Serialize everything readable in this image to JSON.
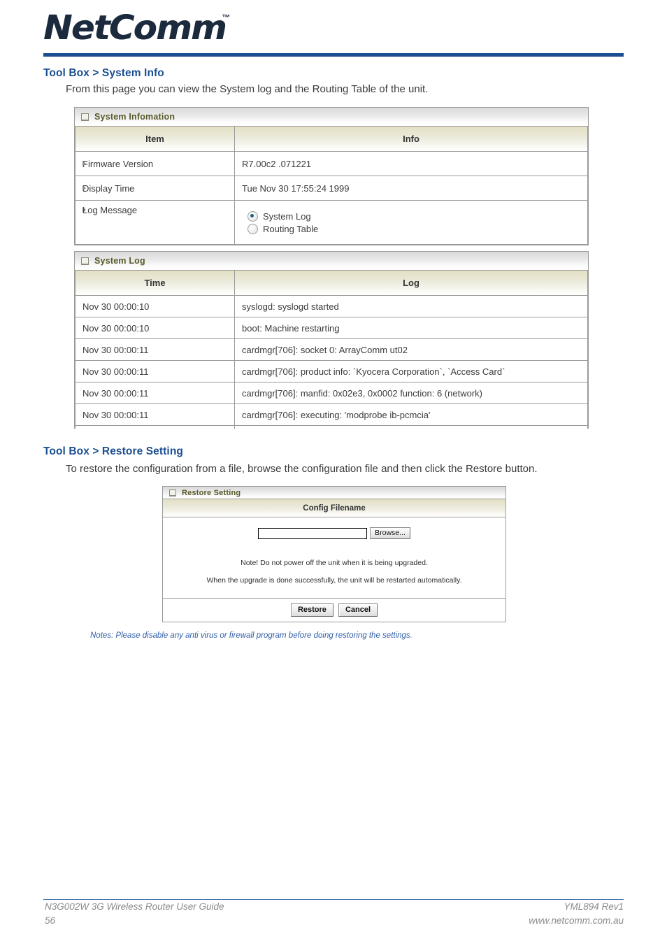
{
  "brand": {
    "logo_text": "NetComm",
    "trademark": "™"
  },
  "sections": [
    {
      "heading": "Tool Box > System Info",
      "body": "From this page you can view the System log and the Routing Table of the unit."
    },
    {
      "heading": "Tool Box > Restore Setting",
      "body": "To restore the configuration from a file, browse the configuration file and then click the Restore button."
    }
  ],
  "system_info_panel": {
    "title": "System Infomation",
    "columns": [
      "Item",
      "Info"
    ],
    "rows": [
      {
        "item": "Firmware Version",
        "info": "R7.00c2 .071221"
      },
      {
        "item": "Display Time",
        "info": "Tue Nov 30 17:55:24 1999"
      }
    ],
    "log_message_row": {
      "item": "Log Message",
      "options": [
        {
          "label": "System Log",
          "selected": true
        },
        {
          "label": "Routing Table",
          "selected": false
        }
      ]
    }
  },
  "system_log_panel": {
    "title": "System Log",
    "columns": [
      "Time",
      "Log"
    ],
    "rows": [
      {
        "time": "Nov 30 00:00:10",
        "log": "syslogd: syslogd started"
      },
      {
        "time": "Nov 30 00:00:10",
        "log": "boot: Machine restarting"
      },
      {
        "time": "Nov 30 00:00:11",
        "log": "cardmgr[706]: socket 0: ArrayComm ut02"
      },
      {
        "time": "Nov 30 00:00:11",
        "log": "cardmgr[706]: product info: `Kyocera Corporation`, `Access Card`"
      },
      {
        "time": "Nov 30 00:00:11",
        "log": "cardmgr[706]: manfid: 0x02e3, 0x0002 function: 6 (network)"
      },
      {
        "time": "Nov 30 00:00:11",
        "log": "cardmgr[706]: executing: 'modprobe ib-pcmcia'"
      },
      {
        "time": "",
        "log": ""
      }
    ]
  },
  "restore_panel": {
    "title": "Restore Setting",
    "column_header": "Config Filename",
    "file_value": "",
    "browse_label": "Browse...",
    "notes": [
      "Note! Do not power off the unit when it is being upgraded.",
      "When the upgrade is done successfully, the unit will be restarted automatically."
    ],
    "restore_label": "Restore",
    "cancel_label": "Cancel"
  },
  "page_notes": "Notes: Please disable any anti virus or firewall program before doing restoring the settings.",
  "footer": {
    "left_line1": "N3G002W 3G Wireless Router User Guide",
    "left_line2": "56",
    "right_line1": "YML894 Rev1",
    "right_line2": "www.netcomm.com.au"
  },
  "colors": {
    "brand_blue": "#1b4f91",
    "heading_blue": "#1b4f91",
    "notes_blue": "#2f5ea8",
    "panel_title_text": "#5a5a2b",
    "radio_dot": "#17637f"
  }
}
